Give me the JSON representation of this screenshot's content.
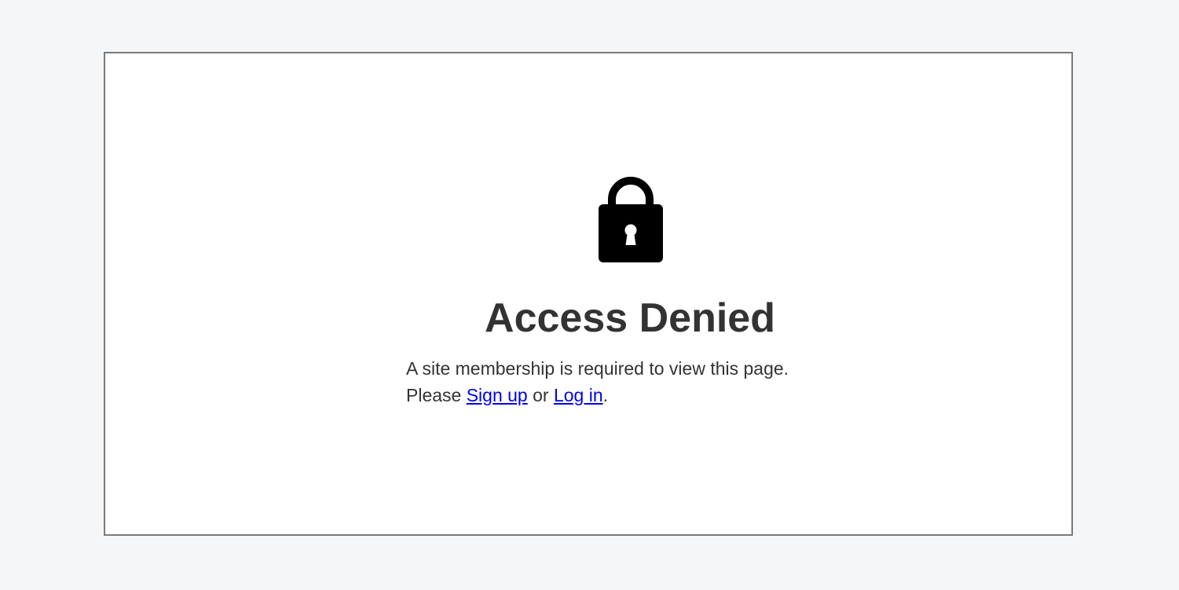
{
  "page": {
    "background_color": "#f5f6f8",
    "frame_border_color": "#7a7a7a"
  },
  "lock_icon": {
    "name": "lock-icon",
    "color": "#000000"
  },
  "heading": {
    "text": "Access Denied",
    "color": "#333333"
  },
  "message": {
    "line1": "A site membership is required to view this page.",
    "please": "Please",
    "signup_link": "Sign up",
    "or": "or",
    "login_link": "Log in",
    "period": ".",
    "link_color": "#0000ee"
  }
}
